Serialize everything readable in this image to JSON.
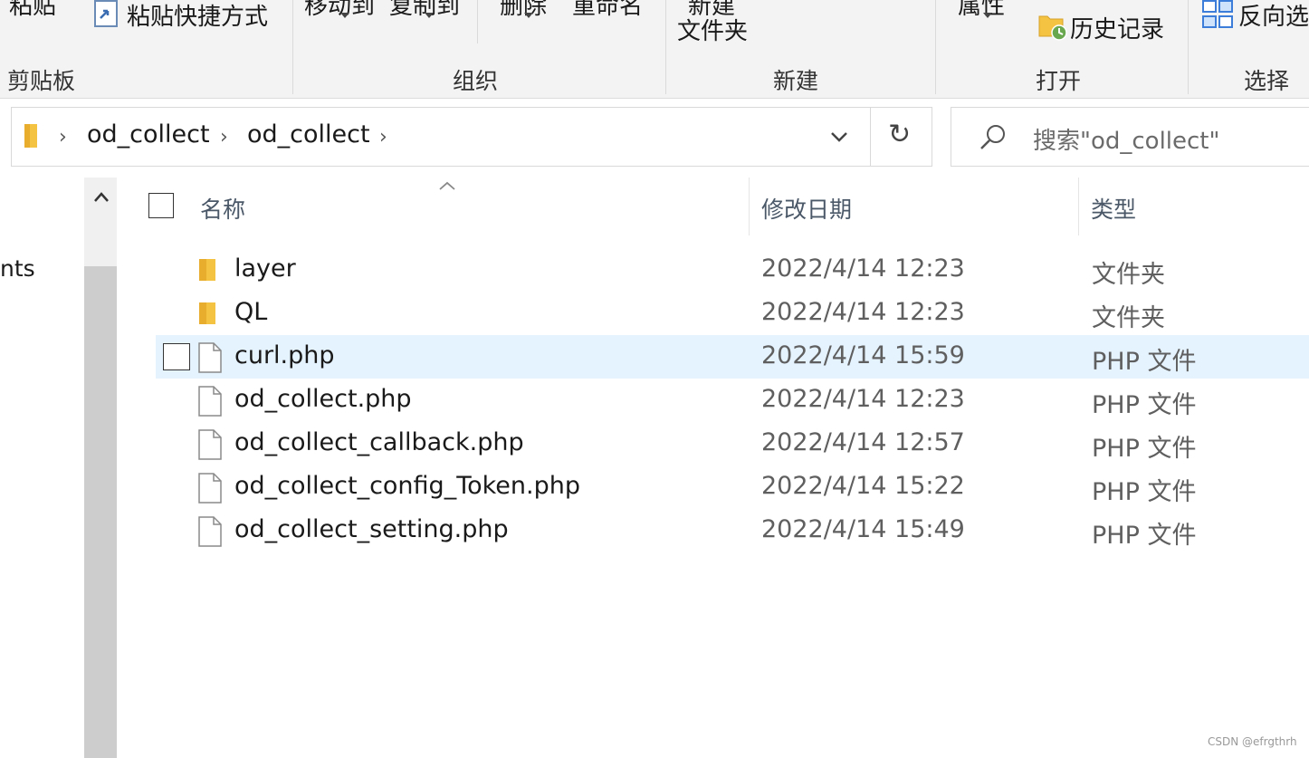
{
  "ribbon": {
    "clip_top": [
      "粘贴",
      "粘贴快捷方式",
      "移动到",
      "复制到",
      "删除",
      "重命名",
      "新建",
      "属性",
      "反向选"
    ],
    "new_folder_label": "文件夹",
    "history_label": "历史记录",
    "groups": {
      "clipboard": "剪贴板",
      "organize": "组织",
      "new": "新建",
      "open": "打开",
      "select": "选择"
    }
  },
  "address": {
    "crumbs": [
      "od_collect",
      "od_collect"
    ]
  },
  "search": {
    "placeholder": "搜索\"od_collect\""
  },
  "nav": {
    "partial_item": "nts"
  },
  "columns": {
    "name": "名称",
    "date": "修改日期",
    "type": "类型"
  },
  "files": [
    {
      "name": "layer",
      "date": "2022/4/14 12:23",
      "type": "文件夹",
      "icon": "folder-icon"
    },
    {
      "name": "QL",
      "date": "2022/4/14 12:23",
      "type": "文件夹",
      "icon": "folder-icon"
    },
    {
      "name": "curl.php",
      "date": "2022/4/14 15:59",
      "type": "PHP 文件",
      "icon": "file-icon"
    },
    {
      "name": "od_collect.php",
      "date": "2022/4/14 12:23",
      "type": "PHP 文件",
      "icon": "file-icon"
    },
    {
      "name": "od_collect_callback.php",
      "date": "2022/4/14 12:57",
      "type": "PHP 文件",
      "icon": "file-icon"
    },
    {
      "name": "od_collect_config_Token.php",
      "date": "2022/4/14 15:22",
      "type": "PHP 文件",
      "icon": "file-icon"
    },
    {
      "name": "od_collect_setting.php",
      "date": "2022/4/14 15:49",
      "type": "PHP 文件",
      "icon": "file-icon"
    }
  ],
  "watermark": "CSDN @efrgthrh",
  "colors": {
    "hover_row": "#e5f3ff",
    "folder": "#f5c342",
    "ribbon_bg": "#f3f3f3"
  }
}
